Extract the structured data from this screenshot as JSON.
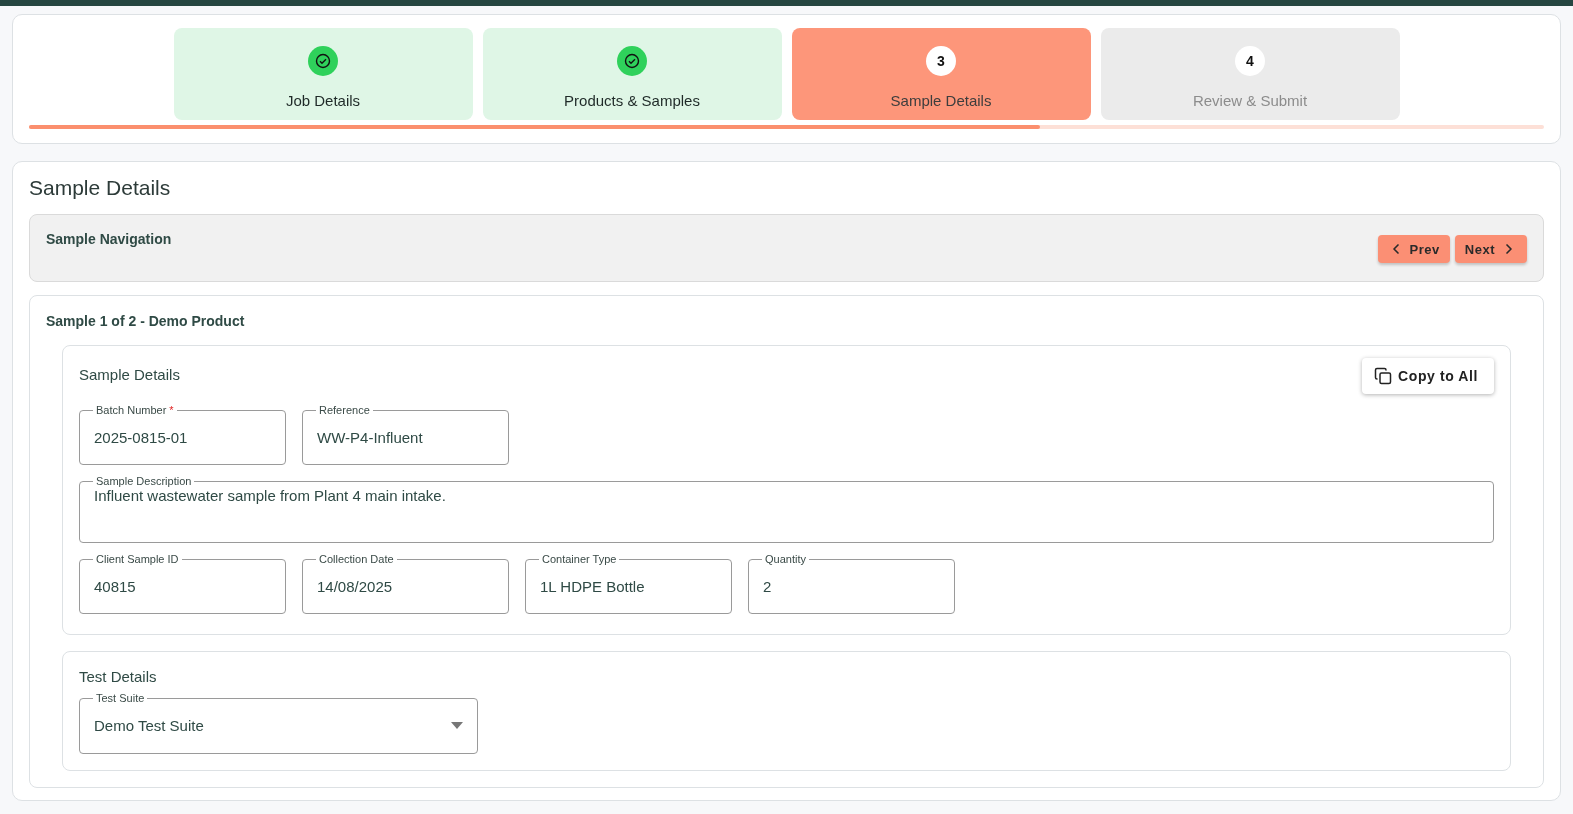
{
  "stepper": {
    "steps": [
      {
        "label": "Job Details",
        "completed": true,
        "selected": false
      },
      {
        "label": "Products & Samples",
        "completed": true,
        "selected": false
      },
      {
        "number": "3",
        "label": "Sample Details",
        "completed": false,
        "selected": true
      },
      {
        "number": "4",
        "label": "Review & Submit",
        "completed": false,
        "selected": false
      }
    ],
    "progress": {
      "level": 0.667
    }
  },
  "page": {
    "title": "Sample Details",
    "navigation": {
      "title": "Sample Navigation",
      "buttons": [
        {
          "label": "Prev",
          "kind": "prev"
        },
        {
          "label": "Next",
          "kind": "next"
        }
      ]
    },
    "sample": {
      "title": "Sample 1 of 2 - Demo Product",
      "details": {
        "title": "Sample Details",
        "copy_button": "Copy to All",
        "rows": [
          [
            {
              "label": "Batch Number",
              "required_mark": "*",
              "value": "2025-0815-01",
              "kind": "text"
            },
            {
              "label": "Reference",
              "value": "WW-P4-Influent",
              "kind": "text"
            }
          ],
          [
            {
              "label": "Sample Description",
              "value": "Influent wastewater sample from Plant 4 main intake.",
              "kind": "textarea"
            }
          ],
          [
            {
              "label": "Client Sample ID",
              "value": "40815",
              "kind": "text"
            },
            {
              "label": "Collection Date",
              "value": "14/08/2025",
              "kind": "text"
            },
            {
              "label": "Container Type",
              "value": "1L HDPE Bottle",
              "kind": "text"
            },
            {
              "label": "Quantity",
              "value": "2",
              "kind": "text"
            }
          ]
        ]
      },
      "tests": {
        "title": "Test Details",
        "fields": [
          {
            "label": "Test Suite",
            "value": "Demo Test Suite",
            "kind": "select"
          }
        ]
      }
    }
  }
}
